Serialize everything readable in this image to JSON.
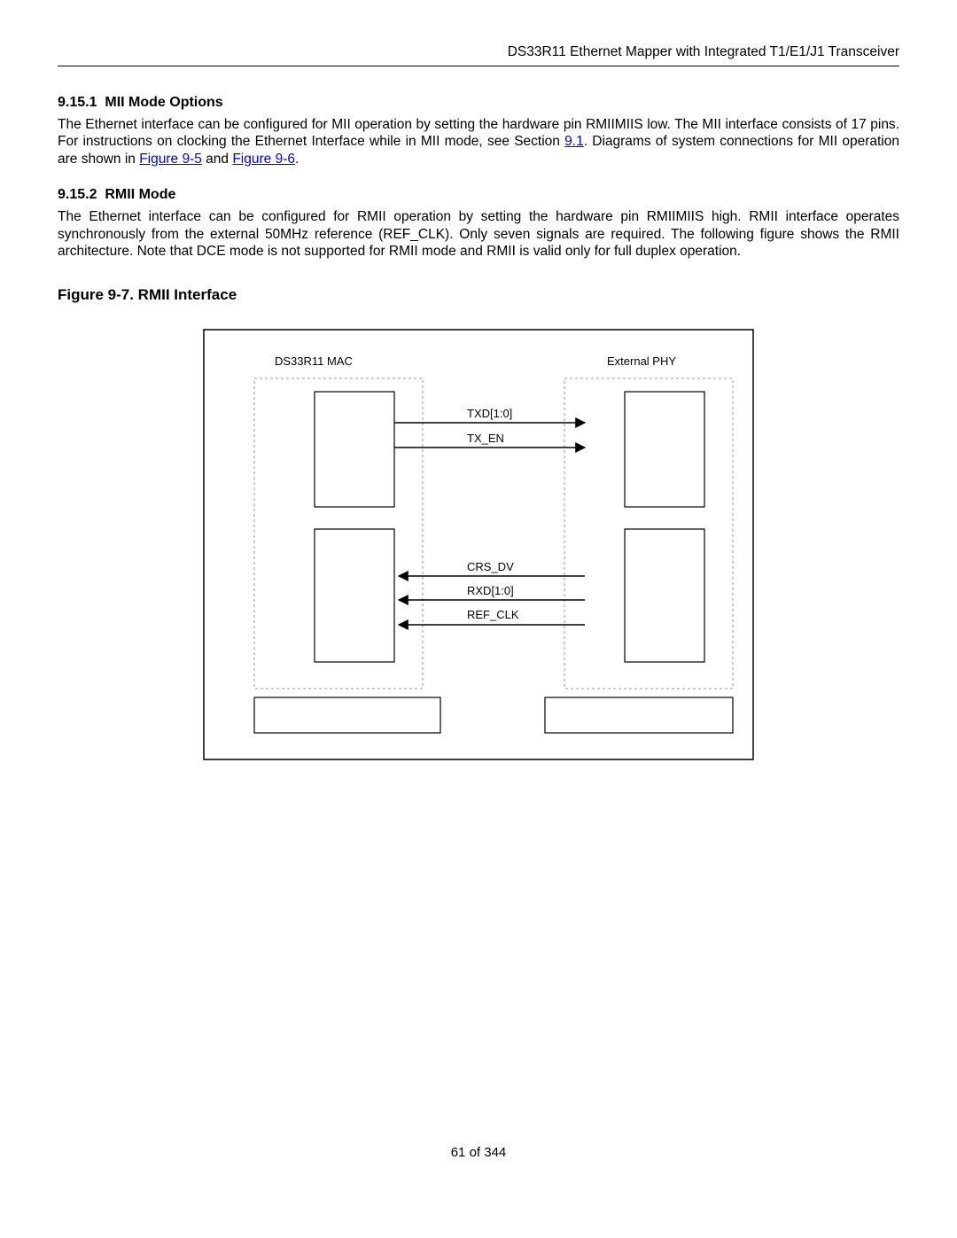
{
  "header": "DS33R11 Ethernet Mapper with Integrated T1/E1/J1 Transceiver",
  "sec1": {
    "num": "9.15.1",
    "title": "MII Mode Options",
    "para_a": "The Ethernet interface can be configured for MII operation by setting the hardware pin RMIIMIIS low. The MII interface consists of 17 pins. For instructions on clocking the Ethernet Interface while in MII mode, see Section ",
    "link_91": "9.1",
    "para_b": ". Diagrams of system connections for MII operation are shown in ",
    "link_f95": "Figure 9-5",
    "and": " and ",
    "link_f96": "Figure 9-6",
    "period": "."
  },
  "sec2": {
    "num": "9.15.2",
    "title": "RMII Mode",
    "para": "The Ethernet interface can be configured for RMII operation by setting the hardware pin RMIIMIIS high. RMII interface operates synchronously from the external 50MHz reference (REF_CLK). Only seven signals are required. The following figure shows the RMII architecture. Note that DCE mode is not supported for RMII mode and RMII is valid only for full duplex operation."
  },
  "fig": {
    "title": "Figure 9-7. RMII Interface",
    "mac": "DS33R11 MAC",
    "phy": "External PHY",
    "sig1": "TXD[1:0]",
    "sig2": "TX_EN",
    "sig3": "CRS_DV",
    "sig4": "RXD[1:0]",
    "sig5": "REF_CLK"
  },
  "footer": "61 of 344"
}
